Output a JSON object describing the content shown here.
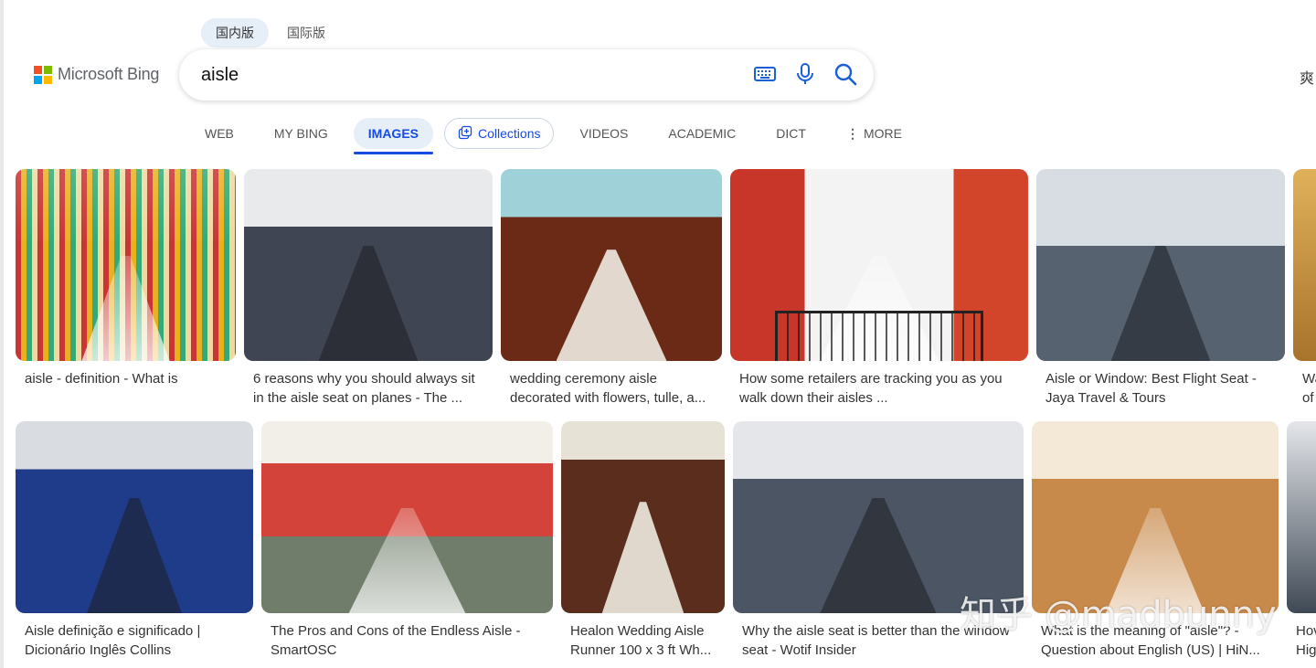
{
  "region": {
    "domestic": "国内版",
    "international": "国际版"
  },
  "logo": {
    "text": "Microsoft Bing",
    "colors": [
      "#f25022",
      "#7fba00",
      "#00a4ef",
      "#ffb900"
    ]
  },
  "search": {
    "query": "aisle",
    "icons": [
      "keyboard-icon",
      "microphone-icon",
      "search-icon"
    ]
  },
  "top_right_char": "爽",
  "tabs": [
    {
      "label": "WEB"
    },
    {
      "label": "MY BING"
    },
    {
      "label": "IMAGES",
      "active": true
    },
    {
      "label": "Collections",
      "icon": "collections-icon"
    },
    {
      "label": "VIDEOS"
    },
    {
      "label": "ACADEMIC"
    },
    {
      "label": "DICT"
    },
    {
      "label": "MORE",
      "icon": "more-dots-icon"
    }
  ],
  "results_row1": [
    {
      "line1": "aisle - definition - What is",
      "line2": ""
    },
    {
      "line1": "6 reasons why you should always sit",
      "line2": "in the aisle seat on planes - The ..."
    },
    {
      "line1": "wedding ceremony aisle",
      "line2": "decorated with flowers, tulle, a..."
    },
    {
      "line1": "How some retailers are tracking you as you",
      "line2": "walk down their aisles ..."
    },
    {
      "line1": "Aisle or Window: Best Flight Seat -",
      "line2": "Jaya Travel & Tours"
    },
    {
      "line1": "Wa",
      "line2": "of"
    }
  ],
  "results_row2": [
    {
      "line1": "Aisle definição e significado |",
      "line2": "Dicionário Inglês Collins"
    },
    {
      "line1": "The Pros and Cons of the Endless Aisle -",
      "line2": "SmartOSC"
    },
    {
      "line1": "Healon Wedding Aisle",
      "line2": "Runner 100 x 3 ft Wh..."
    },
    {
      "line1": "Why the aisle seat is better than the window",
      "line2": "seat - Wotif Insider"
    },
    {
      "line1": "What is the meaning of \"aisle\"? -",
      "line2": "Question about English (US) | HiN..."
    },
    {
      "line1": "Hov",
      "line2": "Hig"
    }
  ],
  "watermark": "知乎 @madbunny",
  "accent_color": "#174ae4"
}
